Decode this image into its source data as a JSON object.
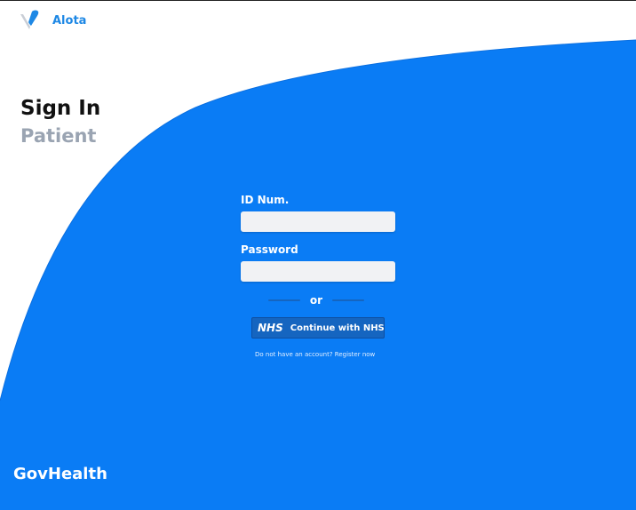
{
  "app": {
    "name": "Alota",
    "brand_color": "#1e88e5",
    "background_accent": "#0a7cf5"
  },
  "heading": {
    "title": "Sign In",
    "subtitle": "Patient"
  },
  "form": {
    "id_label": "ID Num.",
    "id_value": "",
    "password_label": "Password",
    "password_value": "",
    "divider_text": "or"
  },
  "nhs_button": {
    "logo_text": "NHS",
    "label": "Continue with NHS"
  },
  "register": {
    "prompt": "Do not have an account?",
    "link": "Register now"
  },
  "footer": {
    "brand": "GovHealth"
  }
}
